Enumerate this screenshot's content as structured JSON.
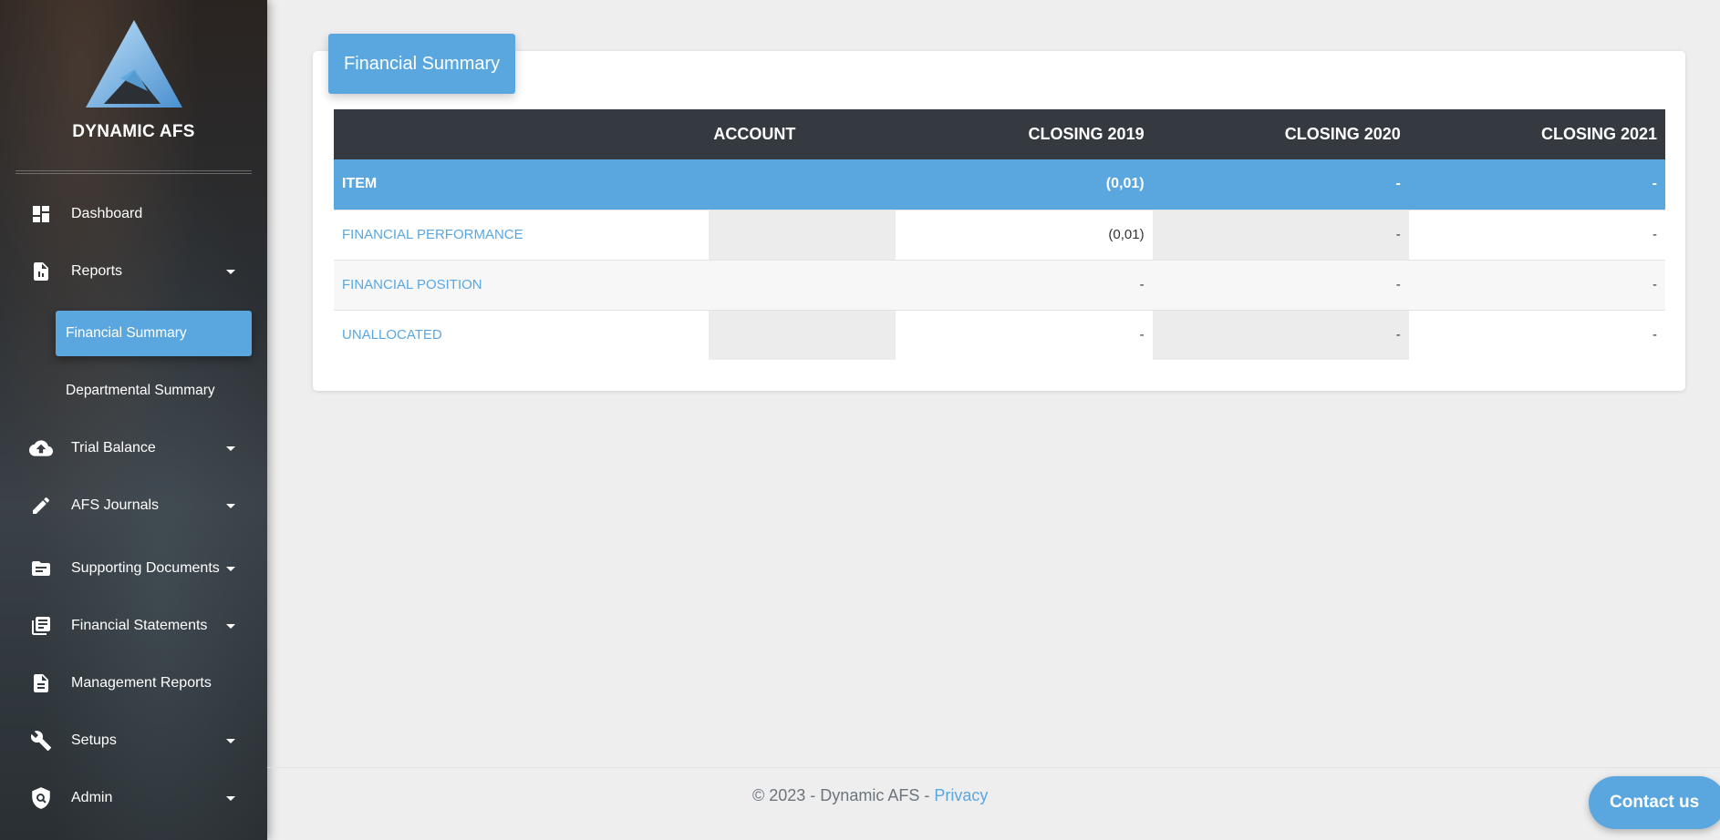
{
  "brand": {
    "name": "DYNAMIC AFS"
  },
  "sidebar": {
    "items": [
      {
        "label": "Dashboard",
        "icon": "dashboard-icon"
      },
      {
        "label": "Reports",
        "icon": "report-icon",
        "expandable": true
      },
      {
        "label": "Trial Balance",
        "icon": "cloud-upload-icon",
        "expandable": true
      },
      {
        "label": "AFS Journals",
        "icon": "pencil-icon",
        "expandable": true
      },
      {
        "label": "Supporting Documents",
        "icon": "folder-icon",
        "expandable": true
      },
      {
        "label": "Financial Statements",
        "icon": "library-books-icon",
        "expandable": true
      },
      {
        "label": "Management Reports",
        "icon": "document-icon"
      },
      {
        "label": "Setups",
        "icon": "wrench-icon",
        "expandable": true
      },
      {
        "label": "Admin",
        "icon": "admin-shield-icon",
        "expandable": true
      }
    ],
    "subitems": [
      {
        "label": "Financial Summary",
        "active": true
      },
      {
        "label": "Departmental Summary",
        "active": false
      }
    ]
  },
  "card": {
    "title": "Financial Summary"
  },
  "table": {
    "headers": [
      "",
      "ACCOUNT",
      "CLOSING 2019",
      "CLOSING 2020",
      "CLOSING 2021"
    ],
    "rows": [
      {
        "label": "ITEM",
        "account": "",
        "y2019": "(0,01)",
        "y2020": "-",
        "y2021": "-"
      },
      {
        "label": "FINANCIAL PERFORMANCE",
        "account": "",
        "y2019": "(0,01)",
        "y2020": "-",
        "y2021": "-"
      },
      {
        "label": "FINANCIAL POSITION",
        "account": "",
        "y2019": "-",
        "y2020": "-",
        "y2021": "-"
      },
      {
        "label": "UNALLOCATED",
        "account": "",
        "y2019": "-",
        "y2020": "-",
        "y2021": "-"
      }
    ]
  },
  "footer": {
    "copyright": "© 2023 - Dynamic AFS - ",
    "privacy": "Privacy"
  },
  "contact": {
    "label": "Contact us"
  },
  "colors": {
    "accent": "#5aa7e0",
    "header": "#343a40",
    "background": "#eeeeee"
  }
}
